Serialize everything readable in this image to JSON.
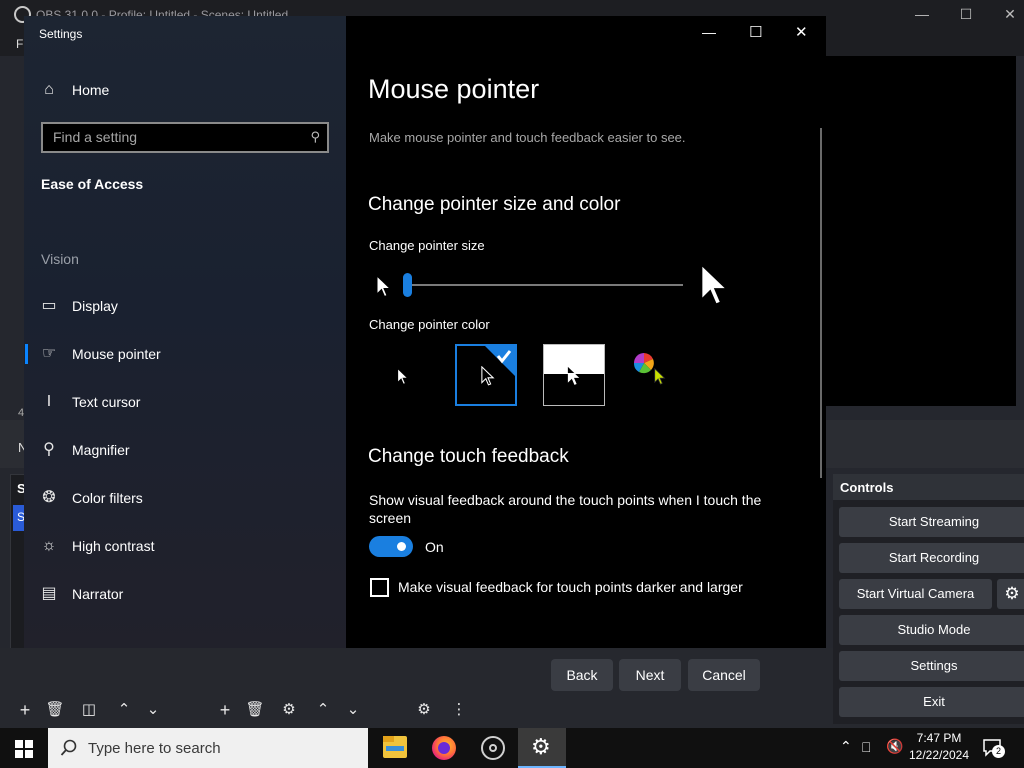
{
  "obs": {
    "window_title": "OBS 31.0.0 - Profile: Untitled - Scenes: Untitled",
    "menu_first": "Fi",
    "controls": {
      "header": "Controls",
      "buttons": [
        "Start Streaming",
        "Start Recording",
        "Start Virtual Camera",
        "Studio Mode",
        "Settings",
        "Exit"
      ]
    },
    "wizard_buttons": {
      "back": "Back",
      "next": "Next",
      "cancel": "Cancel"
    },
    "left_fragments": {
      "a": "4",
      "b": "N",
      "c": "S",
      "d": "S"
    }
  },
  "settings": {
    "app_title": "Settings",
    "home": "Home",
    "search_placeholder": "Find a setting",
    "category": "Ease of Access",
    "group": "Vision",
    "nav": [
      {
        "label": "Display",
        "icon": "display-icon"
      },
      {
        "label": "Mouse pointer",
        "icon": "mouse-pointer-icon",
        "selected": true
      },
      {
        "label": "Text cursor",
        "icon": "text-cursor-icon"
      },
      {
        "label": "Magnifier",
        "icon": "magnifier-icon"
      },
      {
        "label": "Color filters",
        "icon": "color-filters-icon"
      },
      {
        "label": "High contrast",
        "icon": "high-contrast-icon"
      },
      {
        "label": "Narrator",
        "icon": "narrator-icon"
      }
    ],
    "page": {
      "title": "Mouse pointer",
      "description": "Make mouse pointer and touch feedback easier to see.",
      "section_size_color": "Change pointer size and color",
      "size_label": "Change pointer size",
      "size_value": 0.0,
      "color_label": "Change pointer color",
      "color_options": [
        "white",
        "black",
        "inverted",
        "custom"
      ],
      "selected_color": "black",
      "section_touch": "Change touch feedback",
      "touch_label": "Show visual feedback around the touch points when I touch the screen",
      "touch_state": "On",
      "touch_on": true,
      "darker_label": "Make visual feedback for touch points darker and larger",
      "darker_checked": false
    },
    "accent_color": "#1a7fe0"
  },
  "taskbar": {
    "search_placeholder": "Type here to search",
    "time": "7:47 PM",
    "date": "12/22/2024",
    "notification_count": "2"
  }
}
